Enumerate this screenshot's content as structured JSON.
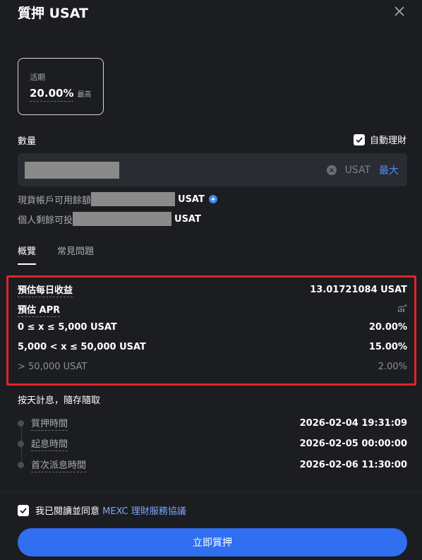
{
  "dialog": {
    "title": "質押 USAT"
  },
  "plan": {
    "type": "活期",
    "rate": "20.00%",
    "max_label": "最高"
  },
  "amount": {
    "label": "數量",
    "auto_invest_label": "自動理財",
    "auto_invest_checked": true,
    "currency": "USAT",
    "max_button": "最大"
  },
  "balance": {
    "available_label": "現貨帳戶可用餘額",
    "available_unit": "USAT",
    "remaining_label": "個人剩餘可投",
    "remaining_unit": "USAT"
  },
  "tabs": [
    {
      "label": "概覽",
      "active": true
    },
    {
      "label": "常見問題",
      "active": false
    }
  ],
  "overview": {
    "daily_income_label": "預估每日收益",
    "daily_income_value": "13.01721084 USAT",
    "apr_label": "預估 APR",
    "tiers": [
      {
        "range": "0 ≤ x ≤ 5,000 USAT",
        "rate": "20.00%",
        "dim": false
      },
      {
        "range": "5,000 < x ≤ 50,000 USAT",
        "rate": "15.00%",
        "dim": false
      },
      {
        "range": "> 50,000 USAT",
        "rate": "2.00%",
        "dim": true
      }
    ]
  },
  "schedule": {
    "note": "按天計息，隨存隨取",
    "items": [
      {
        "label": "質押時間",
        "value": "2026-02-04 19:31:09"
      },
      {
        "label": "起息時間",
        "value": "2026-02-05 00:00:00"
      },
      {
        "label": "首次派息時間",
        "value": "2026-02-06 11:30:00"
      }
    ]
  },
  "footer": {
    "agree_prefix": "我已閱讀並同意",
    "agree_link": "MEXC 理財服務協議",
    "agree_checked": true,
    "submit_label": "立即質押"
  },
  "colors": {
    "background": "#1c1d21",
    "accent": "#2f6ff0",
    "link": "#4b8ef7",
    "highlight_border": "#e0242b"
  }
}
